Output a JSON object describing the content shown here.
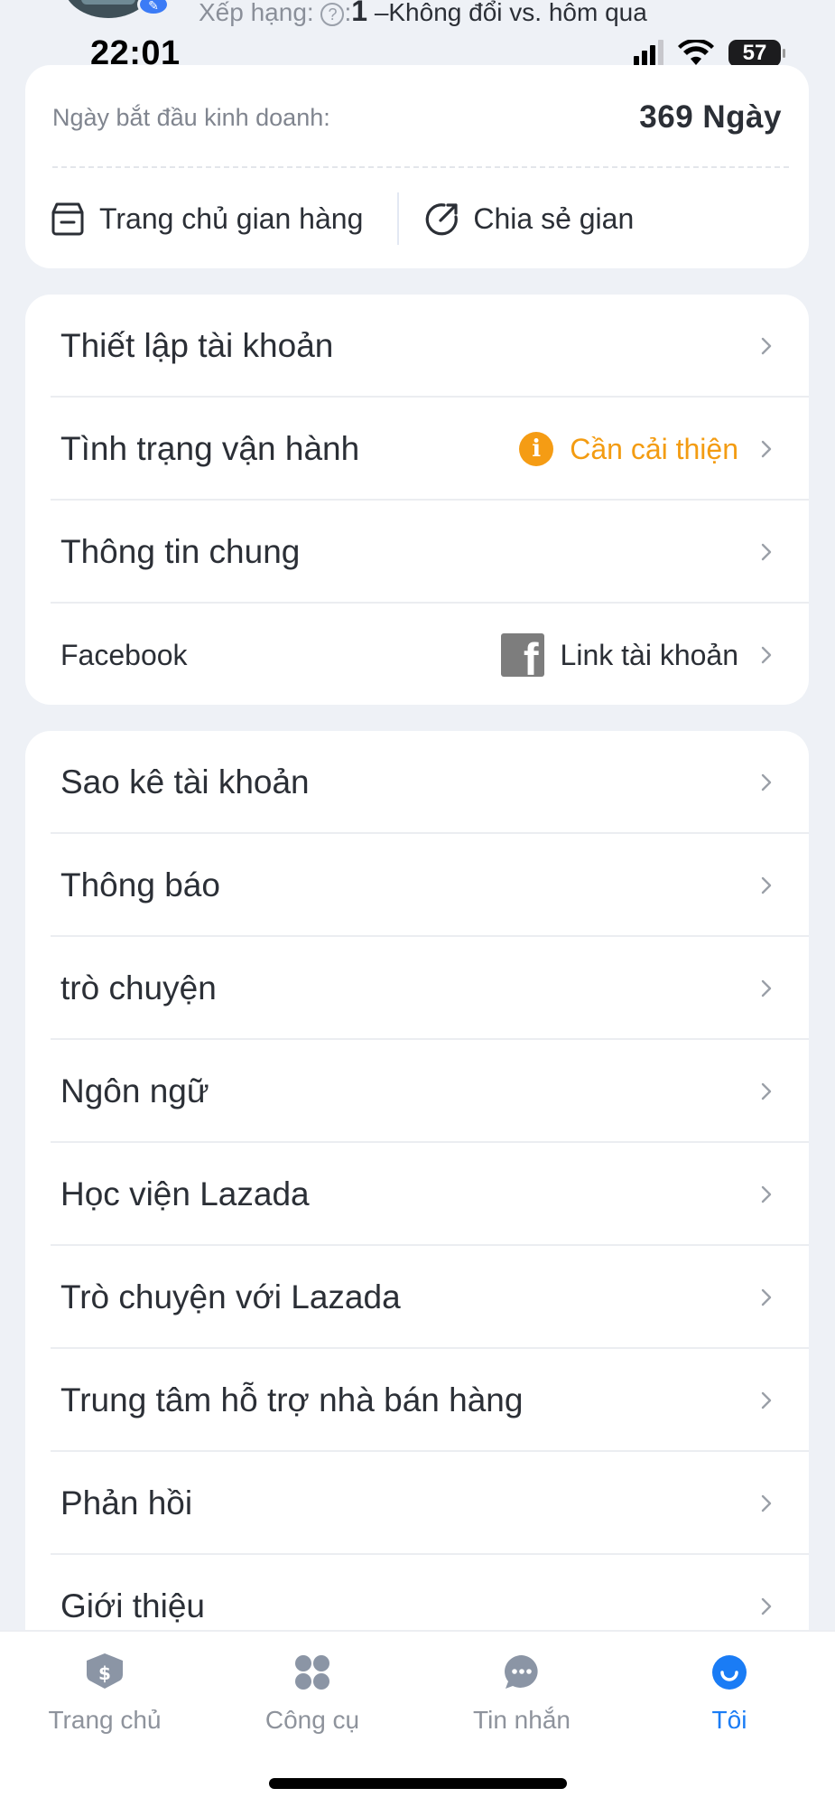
{
  "header": {
    "rank_label": "Xếp hạng:",
    "rank_help_icon": "question-circle-icon",
    "rank_value": "1",
    "rank_change": "–Không đổi",
    "rank_compare": "vs. hôm qua"
  },
  "status_bar": {
    "time": "22:01",
    "battery": "57"
  },
  "shop_card": {
    "start_label": "Ngày bắt đầu kinh doanh:",
    "start_value": "369",
    "start_unit": "Ngày",
    "home_label": "Trang chủ gian hàng",
    "share_label": "Chia sẻ gian"
  },
  "account_menu": [
    {
      "label": "Thiết lập tài khoản"
    },
    {
      "label": "Tình trạng vận hành",
      "status": "Cần cải thiện"
    },
    {
      "label": "Thông tin chung"
    },
    {
      "label": "Facebook",
      "link": "Link tài khoản"
    }
  ],
  "main_menu": [
    {
      "label": "Sao kê tài khoản"
    },
    {
      "label": "Thông báo"
    },
    {
      "label": "trò chuyện"
    },
    {
      "label": "Ngôn ngữ"
    },
    {
      "label": "Học viện Lazada"
    },
    {
      "label": "Trò chuyện với Lazada"
    },
    {
      "label": "Trung tâm hỗ trợ nhà bán hàng"
    },
    {
      "label": "Phản hồi"
    },
    {
      "label": "Giới thiệu"
    }
  ],
  "bottom_nav": [
    {
      "label": "Trang chủ",
      "icon": "home-shield-dollar-icon"
    },
    {
      "label": "Công cụ",
      "icon": "tools-grid-icon"
    },
    {
      "label": "Tin nhắn",
      "icon": "chat-bubble-icon"
    },
    {
      "label": "Tôi",
      "icon": "profile-smile-icon",
      "active": true
    }
  ],
  "colors": {
    "accent": "#1a7cf5",
    "warning": "#f39c12",
    "background": "#eef1f6"
  }
}
